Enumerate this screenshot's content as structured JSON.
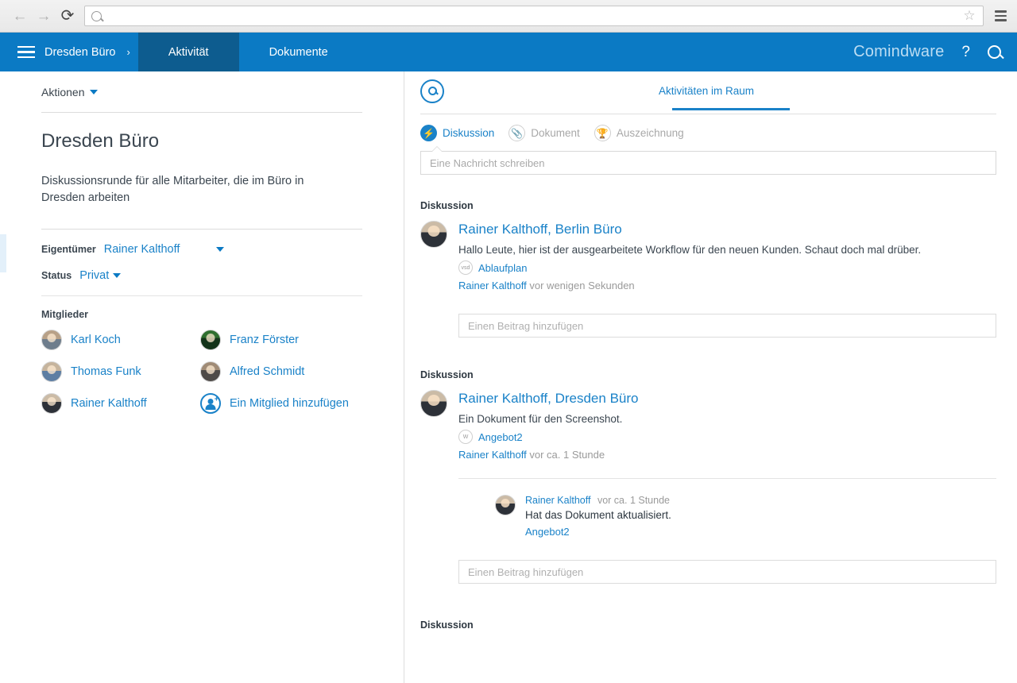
{
  "browser": {
    "back_icon": "back-arrow-icon",
    "forward_icon": "forward-arrow-icon",
    "reload_icon": "reload-icon",
    "url_value": "",
    "url_placeholder": "",
    "bookmark_icon": "star-icon",
    "menu_icon": "hamburger-menu-icon"
  },
  "header": {
    "menu_icon": "hamburger-menu-icon",
    "breadcrumb": "Dresden Büro",
    "breadcrumb_chevron": "›",
    "tabs": [
      {
        "label": "Aktivität",
        "active": true
      },
      {
        "label": "Dokumente",
        "active": false
      }
    ],
    "brand": "Comindware",
    "help_label": "?",
    "search_icon": "search-icon",
    "bg_color": "#0b7ac4",
    "active_tab_color": "#0d5c8f",
    "brand_color": "#bcddf3"
  },
  "left_panel": {
    "actions_label": "Aktionen",
    "actions_caret": "caret-down-icon",
    "title": "Dresden Büro",
    "description": "Diskussionsrunde für alle Mitarbeiter, die im Büro in Dresden arbeiten",
    "owner_label": "Eigentümer",
    "owner_value": "Rainer Kalthoff",
    "owner_caret": "caret-down-icon",
    "status_label": "Status",
    "status_value": "Privat",
    "status_caret": "caret-down-icon",
    "members_label": "Mitglieder",
    "members": [
      {
        "name": "Karl Koch",
        "avatar": "p1"
      },
      {
        "name": "Franz Förster",
        "avatar": "p2"
      },
      {
        "name": "Thomas Funk",
        "avatar": "p3"
      },
      {
        "name": "Alfred Schmidt",
        "avatar": "p4"
      },
      {
        "name": "Rainer Kalthoff",
        "avatar": "p5"
      }
    ],
    "add_member_label": "Ein Mitglied hinzufügen",
    "add_member_icon": "add-user-icon",
    "link_color": "#1a82c8"
  },
  "right_panel": {
    "search_icon": "search-circle-icon",
    "tab_label": "Aktivitäten im Raum",
    "type_filters": [
      {
        "label": "Diskussion",
        "icon": "chat-bolt-icon",
        "active": true
      },
      {
        "label": "Dokument",
        "icon": "paperclip-icon",
        "active": false
      },
      {
        "label": "Auszeichnung",
        "icon": "trophy-icon",
        "active": false
      }
    ],
    "message_placeholder": "Eine Nachricht schreiben",
    "comment_placeholder": "Einen Beitrag hinzufügen",
    "section_label": "Diskussion",
    "posts": [
      {
        "section_label": "Diskussion",
        "author": "Rainer Kalthoff, Berlin Büro",
        "text": "Hallo Leute, hier ist der ausgearbeitete Workflow für den neuen Kunden. Schaut doch mal drüber.",
        "attachment": {
          "name": "Ablaufplan",
          "type": "vsd"
        },
        "meta_who": "Rainer Kalthoff",
        "meta_when": "vor wenigen Sekunden",
        "comment_placeholder": "Einen Beitrag hinzufügen",
        "replies": []
      },
      {
        "section_label": "Diskussion",
        "author": "Rainer Kalthoff, Dresden Büro",
        "text": "Ein Dokument für den Screenshot.",
        "attachment": {
          "name": "Angebot2",
          "type": "W"
        },
        "meta_who": "Rainer Kalthoff",
        "meta_when": "vor ca. 1 Stunde",
        "comment_placeholder": "Einen Beitrag hinzufügen",
        "replies": [
          {
            "who": "Rainer Kalthoff",
            "when": "vor ca. 1 Stunde",
            "text": "Hat das Dokument aktualisiert.",
            "link": "Angebot2"
          }
        ]
      },
      {
        "section_label": "Diskussion"
      }
    ]
  }
}
